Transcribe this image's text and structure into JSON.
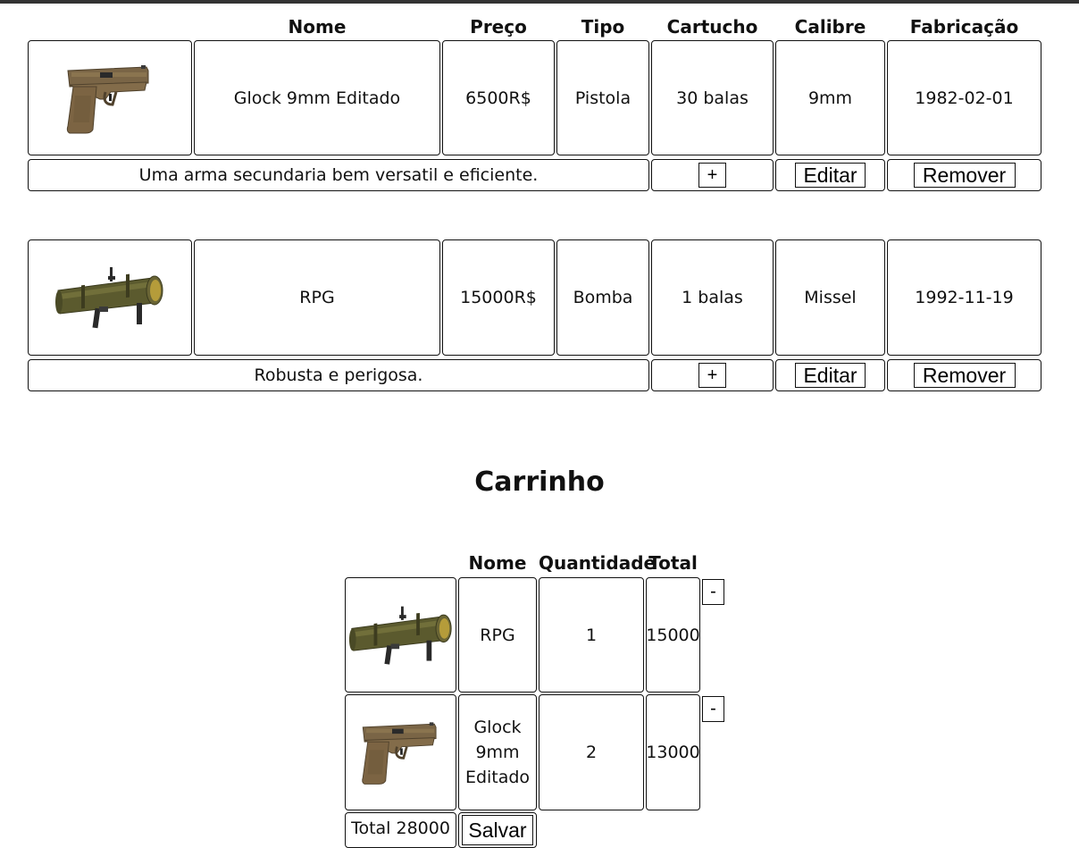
{
  "headers": {
    "nome": "Nome",
    "preco": "Preço",
    "tipo": "Tipo",
    "cartucho": "Cartucho",
    "calibre": "Calibre",
    "fabricacao": "Fabricação"
  },
  "products": [
    {
      "image": "pistol-image",
      "nome": "Glock 9mm Editado",
      "preco": "6500R$",
      "tipo": "Pistola",
      "cartucho": "30 balas",
      "calibre": "9mm",
      "fabricacao": "1982-02-01",
      "descricao": "Uma arma secundaria bem versatil e eficiente.",
      "add_label": "+",
      "edit_label": "Editar",
      "remove_label": "Remover"
    },
    {
      "image": "rpg-image",
      "nome": "RPG",
      "preco": "15000R$",
      "tipo": "Bomba",
      "cartucho": "1 balas",
      "calibre": "Missel",
      "fabricacao": "1992-11-19",
      "descricao": "Robusta e perigosa.",
      "add_label": "+",
      "edit_label": "Editar",
      "remove_label": "Remover"
    }
  ],
  "cart": {
    "title": "Carrinho",
    "headers": {
      "nome": "Nome",
      "quantidade": "Quantidade",
      "total": "Total"
    },
    "items": [
      {
        "image": "rpg-image",
        "nome": "RPG",
        "quantidade": "1",
        "total": "15000",
        "minus_label": "-"
      },
      {
        "image": "pistol-image",
        "nome": "Glock 9mm Editado",
        "quantidade": "2",
        "total": "13000",
        "minus_label": "-"
      }
    ],
    "grand_total": "Total 28000",
    "save_label": "Salvar"
  }
}
